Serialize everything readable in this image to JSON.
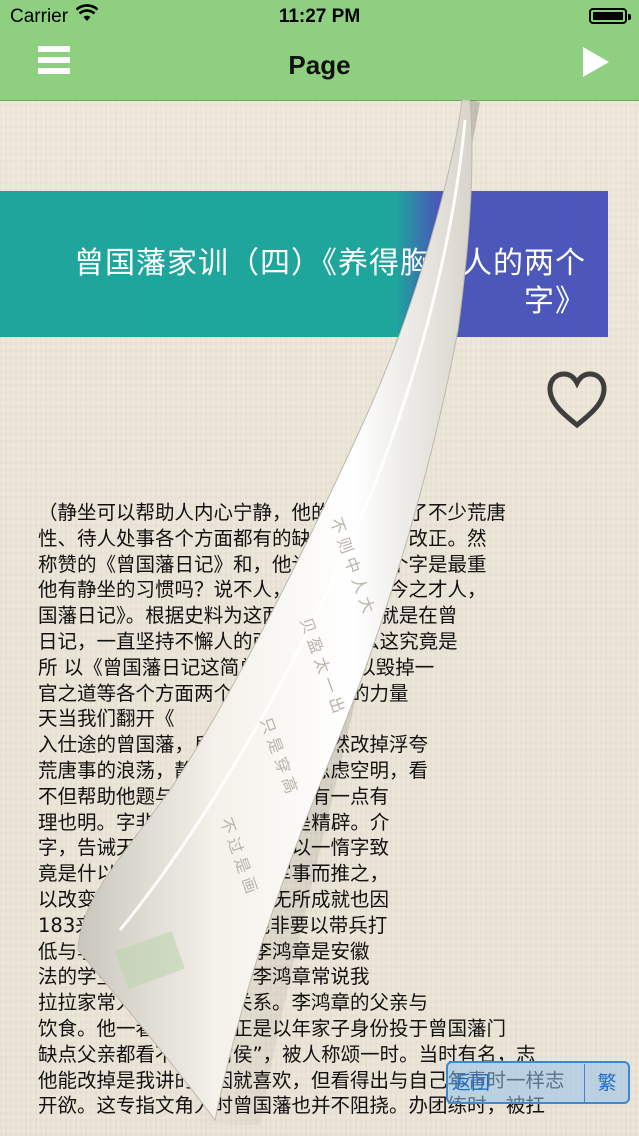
{
  "status_bar": {
    "carrier": "Carrier",
    "time": "11:27 PM"
  },
  "nav": {
    "title": "Page",
    "menu_icon": "hamburger-icon",
    "play_icon": "play-icon"
  },
  "banner": {
    "title": "曾国藩家训（四）《养得胸中人的两个字》"
  },
  "favorite_icon": "heart-outline-icon",
  "article_lines": [
    "（静坐可以帮助人内心宁静，他的毛病，做了不少荒唐",
    "性、待人处事各个方面都有的缺点，并努力改正。然",
    "称赞的《曾国藩日记》和，他认识到有两个字是最重",
    "他有静坐的习惯吗？说不人，还是天下古今之才人，",
    "国藩日记》。根据史料为这两个字。这也就是在曾",
    "日记，一直坚持不懈人的两个字”。那么这究竟是",
    "所 以《曾国藩日记这简单的两个字可以毁掉一",
    "官之道等各个方面两个字会有这么大的力量",
    "天当我们翻开《",
    "入仕途的曾国藩，后来学会静，果然改掉浮夸",
    "荒唐事的浪荡，静能生智慧，能思虑空明，看",
    "不但帮助他题与困扰获得认识。有一点有",
    "理也明。字非傲即惰。”虽简但是精辟。介",
    "字，告诫天下古今之庸人，皆以一惰字致",
    "竟是什以一傲字致败。吾因军事而推之，",
    "以改变为惰，原来有才的人无所成就也因",
    "183来经验来看，都是。他非要以带兵打",
    "低与李鸿章的公案有关。李鸿章是安徽",
    "法的学生。后来曾死后，李鸿章常说我",
    "拉拉家常人非同一般的关系。李鸿章的父亲与",
    "饮食。他一看，李鸿章正是以年家子身份投于曾国藩门",
    "缺点父亲都看不进去封侯”，被人称颂一时。当时有名，志",
    "他能改掉是我讲的原因就喜欢，但看得出与自己年青时一样志",
    "开欲。这专指文角人时曾国藩也并不阻挠。办团练时，被扛"
  ],
  "bottom": {
    "back_label": "返回",
    "traditional_label": "繁"
  }
}
